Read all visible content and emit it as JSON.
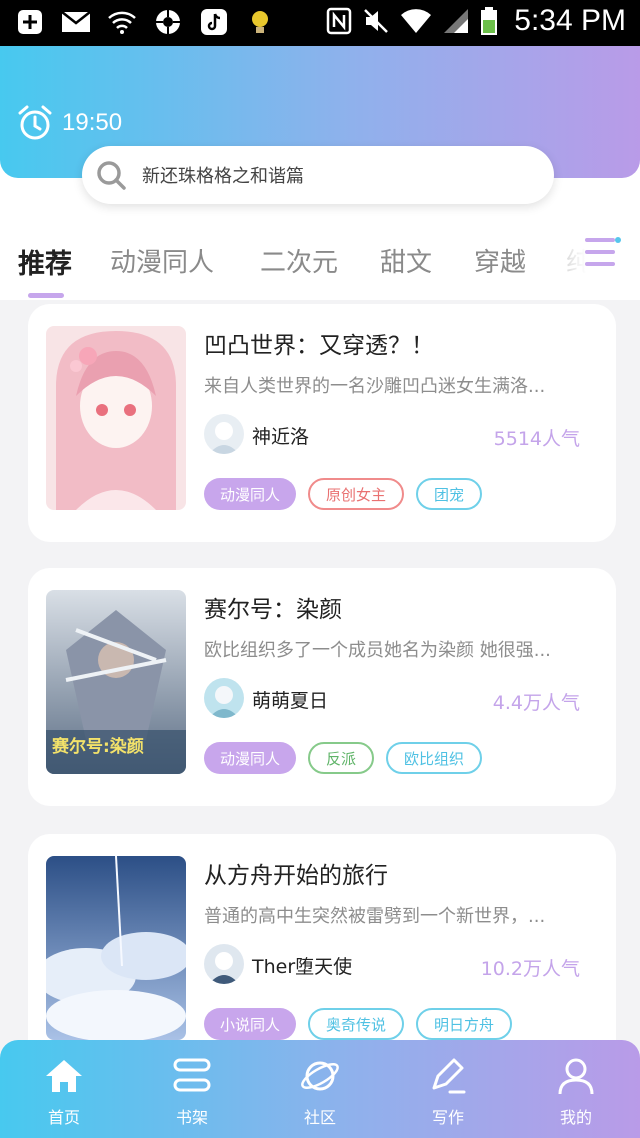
{
  "status_bar": {
    "time": "5:34 PM"
  },
  "header": {
    "timer_text": "19:50"
  },
  "search": {
    "placeholder_text": "新还珠格格之和谐篇"
  },
  "tabs": [
    {
      "label": "推荐",
      "active": true
    },
    {
      "label": "动漫同人"
    },
    {
      "label": "二次元"
    },
    {
      "label": "甜文"
    },
    {
      "label": "穿越"
    },
    {
      "label": "纯爱"
    }
  ],
  "books": [
    {
      "title": "凹凸世界：又穿透？！",
      "description": "来自人类世界的一名沙雕凹凸迷女生满洛...",
      "author": "神近洛",
      "popularity": "5514人气",
      "tags": [
        {
          "label": "动漫同人",
          "style": "purple"
        },
        {
          "label": "原创女主",
          "style": "red"
        },
        {
          "label": "团宠",
          "style": "cyan"
        }
      ]
    },
    {
      "title": "赛尔号：染颜",
      "description": "欧比组织多了一个成员她名为染颜 她很强...",
      "author": "萌萌夏日",
      "popularity": "4.4万人气",
      "cover_text": "赛尔号:染颜",
      "tags": [
        {
          "label": "动漫同人",
          "style": "purple"
        },
        {
          "label": "反派",
          "style": "green"
        },
        {
          "label": "欧比组织",
          "style": "cyan"
        }
      ]
    },
    {
      "title": "从方舟开始的旅行",
      "description": "普通的高中生突然被雷劈到一个新世界，...",
      "author": "Ther堕天使",
      "popularity": "10.2万人气",
      "tags": [
        {
          "label": "小说同人",
          "style": "purple"
        },
        {
          "label": "奥奇传说",
          "style": "cyan"
        },
        {
          "label": "明日方舟",
          "style": "cyan"
        }
      ]
    }
  ],
  "bottom_nav": [
    {
      "label": "首页",
      "icon": "home-icon",
      "active": true
    },
    {
      "label": "书架",
      "icon": "bookshelf-icon"
    },
    {
      "label": "社区",
      "icon": "planet-icon"
    },
    {
      "label": "写作",
      "icon": "pen-icon"
    },
    {
      "label": "我的",
      "icon": "user-icon"
    }
  ],
  "colors": {
    "accent_purple": "#c8a6ec",
    "gradient_start": "#47c9ef",
    "gradient_end": "#b99be8"
  }
}
